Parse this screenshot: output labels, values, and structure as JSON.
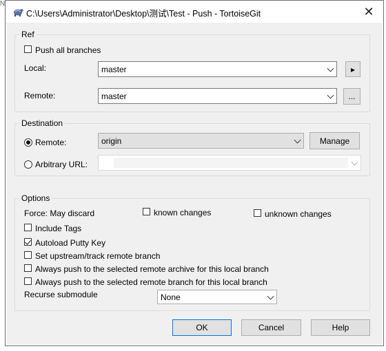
{
  "window": {
    "title": "C:\\Users\\Administrator\\Desktop\\测试\\Test - Push - TortoiseGit",
    "close_glyph": "✕"
  },
  "ref": {
    "legend": "Ref",
    "push_all_branches": {
      "label": "Push all branches",
      "checked": false
    },
    "local": {
      "label": "Local:",
      "value": "master",
      "button_glyph": "▸"
    },
    "remote": {
      "label": "Remote:",
      "value": "master",
      "button_label": "..."
    }
  },
  "destination": {
    "legend": "Destination",
    "remote": {
      "label": "Remote:",
      "selected": true,
      "value": "origin",
      "manage_label": "Manage"
    },
    "arbitrary": {
      "label": "Arbitrary URL:",
      "selected": false,
      "value": ""
    }
  },
  "options": {
    "legend": "Options",
    "force_label": "Force: May discard",
    "known_changes": {
      "label": "known changes",
      "checked": false
    },
    "unknown_changes": {
      "label": "unknown changes",
      "checked": false
    },
    "include_tags": {
      "label": "Include Tags",
      "checked": false
    },
    "autoload_putty": {
      "label": "Autoload Putty Key",
      "checked": true
    },
    "set_upstream": {
      "label": "Set upstream/track remote branch",
      "checked": false
    },
    "always_archive": {
      "label": "Always push to the selected remote archive for this local branch",
      "checked": false
    },
    "always_branch": {
      "label": "Always push to the selected remote branch for this local branch",
      "checked": false
    },
    "recurse_label": "Recurse submodule",
    "recurse_value": "None"
  },
  "buttons": {
    "ok": "OK",
    "cancel": "Cancel",
    "help": "Help"
  }
}
